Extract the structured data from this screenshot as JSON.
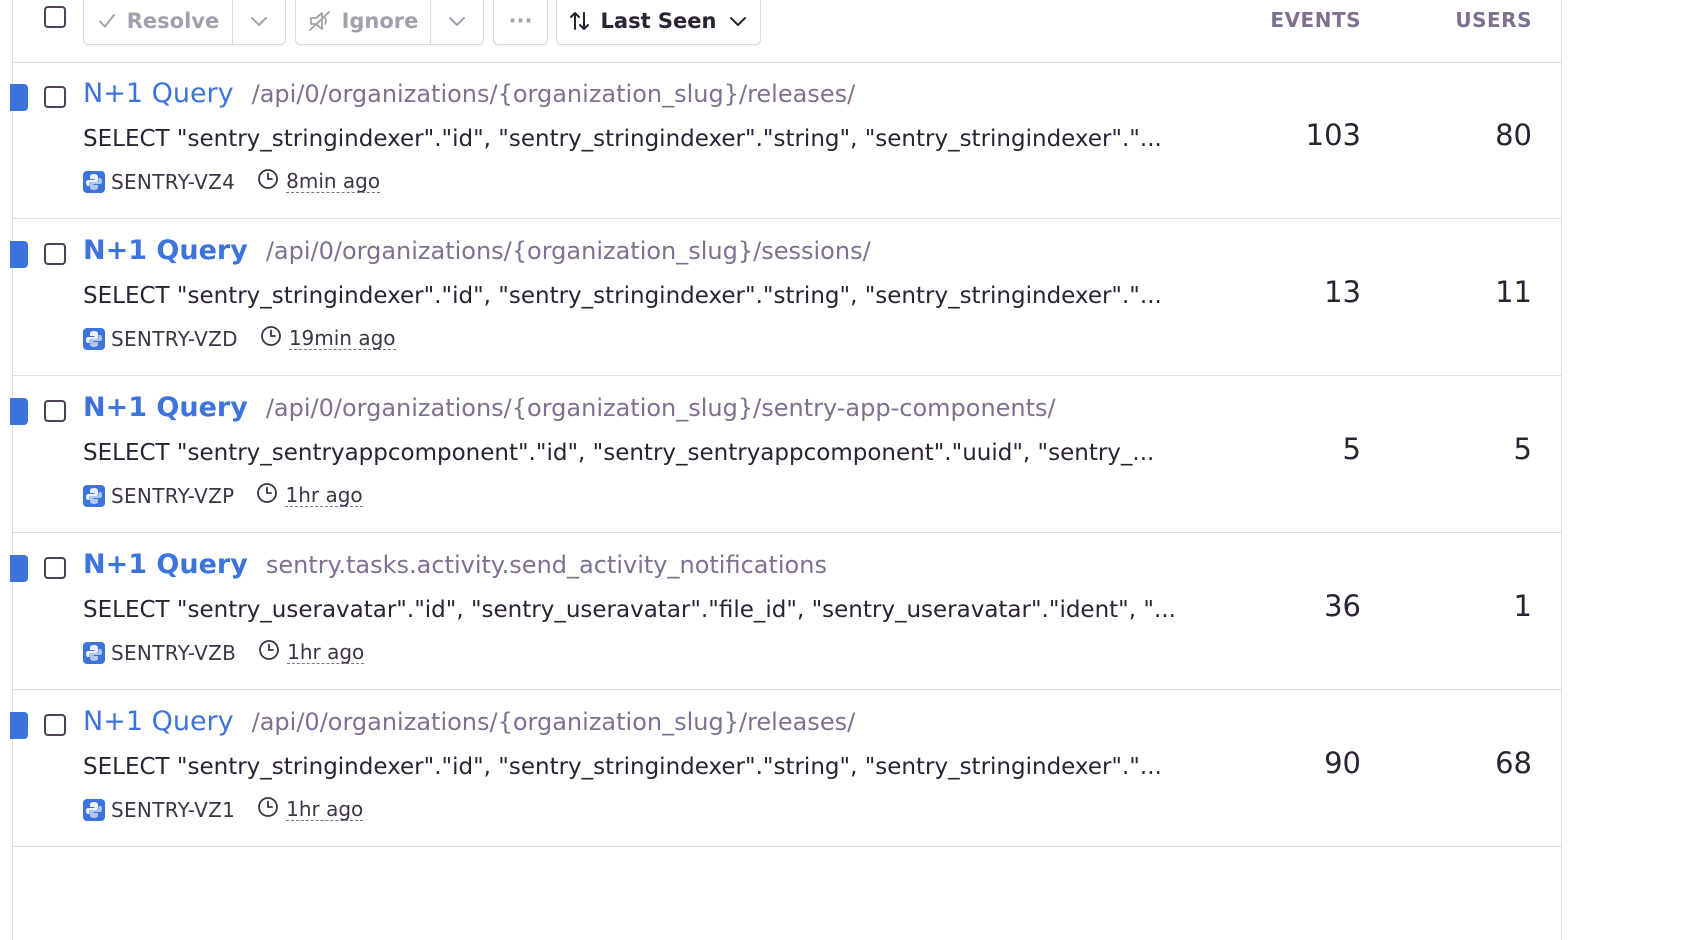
{
  "toolbar": {
    "resolve_label": "Resolve",
    "ignore_label": "Ignore",
    "more_label": "···",
    "sort_label": "Last Seen"
  },
  "columns": {
    "events": "EVENTS",
    "users": "USERS"
  },
  "colors": {
    "accent": "#3d74db",
    "muted": "#80708f",
    "text": "#2b2233"
  },
  "issues": [
    {
      "title": "N+1 Query",
      "location": "/api/0/organizations/{organization_slug}/releases/",
      "message": "SELECT \"sentry_stringindexer\".\"id\", \"sentry_stringindexer\".\"string\", \"sentry_stringindexer\".\"...",
      "short_id": "SENTRY-VZ4",
      "last_seen": "8min ago",
      "events": "103",
      "users": "80",
      "platform_icon": "python-icon"
    },
    {
      "title": "N+1 Query",
      "location": "/api/0/organizations/{organization_slug}/sessions/",
      "message": "SELECT \"sentry_stringindexer\".\"id\", \"sentry_stringindexer\".\"string\", \"sentry_stringindexer\".\"...",
      "short_id": "SENTRY-VZD",
      "last_seen": "19min ago",
      "events": "13",
      "users": "11",
      "platform_icon": "python-icon"
    },
    {
      "title": "N+1 Query",
      "location": "/api/0/organizations/{organization_slug}/sentry-app-components/",
      "message": "SELECT \"sentry_sentryappcomponent\".\"id\", \"sentry_sentryappcomponent\".\"uuid\", \"sentry_...",
      "short_id": "SENTRY-VZP",
      "last_seen": "1hr ago",
      "events": "5",
      "users": "5",
      "platform_icon": "python-icon"
    },
    {
      "title": "N+1 Query",
      "location": "sentry.tasks.activity.send_activity_notifications",
      "message": "SELECT \"sentry_useravatar\".\"id\", \"sentry_useravatar\".\"file_id\", \"sentry_useravatar\".\"ident\", \"...",
      "short_id": "SENTRY-VZB",
      "last_seen": "1hr ago",
      "events": "36",
      "users": "1",
      "platform_icon": "python-icon"
    },
    {
      "title": "N+1 Query",
      "location": "/api/0/organizations/{organization_slug}/releases/",
      "message": "SELECT \"sentry_stringindexer\".\"id\", \"sentry_stringindexer\".\"string\", \"sentry_stringindexer\".\"...",
      "short_id": "SENTRY-VZ1",
      "last_seen": "1hr ago",
      "events": "90",
      "users": "68",
      "platform_icon": "python-icon"
    }
  ]
}
